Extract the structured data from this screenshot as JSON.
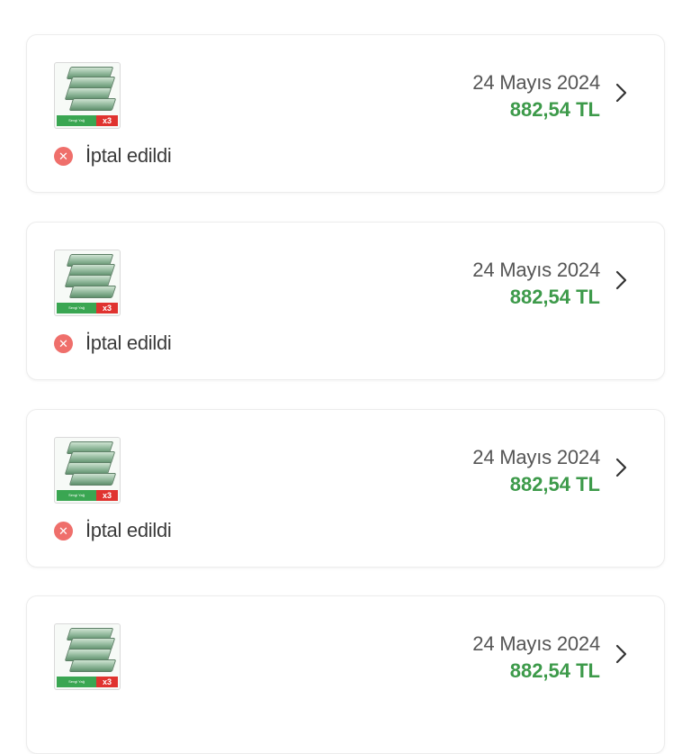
{
  "orders": [
    {
      "date": "24 Mayıs 2024",
      "price": "882,54 TL",
      "status": "İptal edildi",
      "product_bar_text": "Sevgi Yağ",
      "product_badge": "x3"
    },
    {
      "date": "24 Mayıs 2024",
      "price": "882,54 TL",
      "status": "İptal edildi",
      "product_bar_text": "Sevgi Yağ",
      "product_badge": "x3"
    },
    {
      "date": "24 Mayıs 2024",
      "price": "882,54 TL",
      "status": "İptal edildi",
      "product_bar_text": "Sevgi Yağ",
      "product_badge": "x3"
    },
    {
      "date": "24 Mayıs 2024",
      "price": "882,54 TL",
      "status": "",
      "product_bar_text": "Sevgi Yağ",
      "product_badge": "x3"
    }
  ],
  "icons": {
    "status": "cancel-circle-icon",
    "arrow": "chevron-right-icon"
  },
  "colors": {
    "price": "#3d9a4a",
    "cancel": "#ef6f6b"
  }
}
